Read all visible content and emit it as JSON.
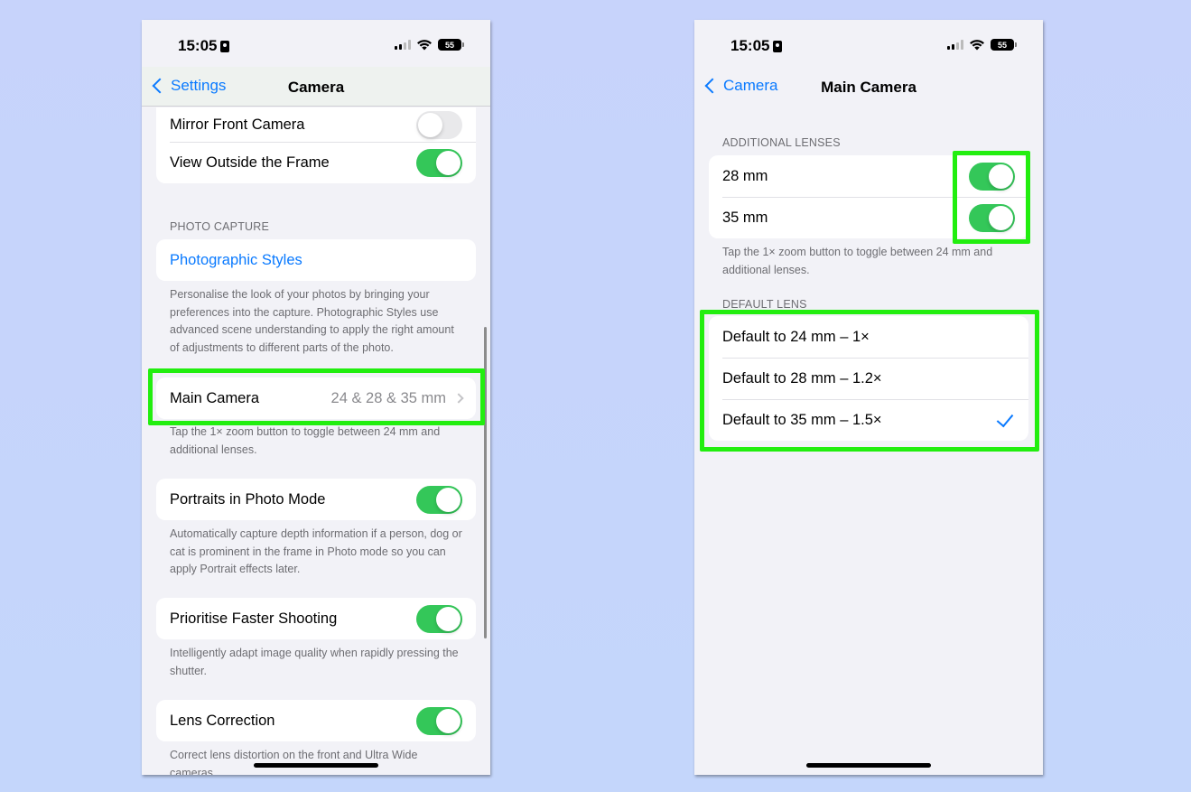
{
  "left_phone": {
    "status": {
      "time": "15:05",
      "battery": "55"
    },
    "nav": {
      "back_label": "Settings",
      "title": "Camera"
    },
    "top_group": {
      "rows": [
        {
          "label": "Mirror Front Camera",
          "toggle": "off"
        },
        {
          "label": "View Outside the Frame",
          "toggle": "on"
        }
      ]
    },
    "photo_capture": {
      "header": "PHOTO CAPTURE",
      "styles_label": "Photographic Styles",
      "styles_footer": "Personalise the look of your photos by bringing your preferences into the capture. Photographic Styles use advanced scene understanding to apply the right amount of adjustments to different parts of the photo."
    },
    "main_camera": {
      "label": "Main Camera",
      "value": "24 & 28 & 35 mm",
      "footer": "Tap the 1× zoom button to toggle between 24 mm and additional lenses."
    },
    "portraits": {
      "label": "Portraits in Photo Mode",
      "toggle": "on",
      "footer": "Automatically capture depth information if a person, dog or cat is prominent in the frame in Photo mode so you can apply Portrait effects later."
    },
    "faster_shooting": {
      "label": "Prioritise Faster Shooting",
      "toggle": "on",
      "footer": "Intelligently adapt image quality when rapidly pressing the shutter."
    },
    "lens_correction": {
      "label": "Lens Correction",
      "toggle": "on",
      "footer": "Correct lens distortion on the front and Ultra Wide cameras."
    }
  },
  "right_phone": {
    "status": {
      "time": "15:05",
      "battery": "55"
    },
    "nav": {
      "back_label": "Camera",
      "title": "Main Camera"
    },
    "additional_lenses": {
      "header": "ADDITIONAL LENSES",
      "rows": [
        {
          "label": "28 mm",
          "toggle": "on"
        },
        {
          "label": "35 mm",
          "toggle": "on"
        }
      ],
      "footer": "Tap the 1× zoom button to toggle between 24 mm and additional lenses."
    },
    "default_lens": {
      "header": "DEFAULT LENS",
      "options": [
        {
          "label": "Default to 24 mm – 1×",
          "selected": false
        },
        {
          "label": "Default to 28 mm – 1.2×",
          "selected": false
        },
        {
          "label": "Default to 35 mm – 1.5×",
          "selected": true
        }
      ]
    }
  },
  "colors": {
    "accent": "#0a7aff",
    "toggle_on": "#34c759",
    "highlight": "#22ee0f",
    "background": "#c6d4fb"
  }
}
